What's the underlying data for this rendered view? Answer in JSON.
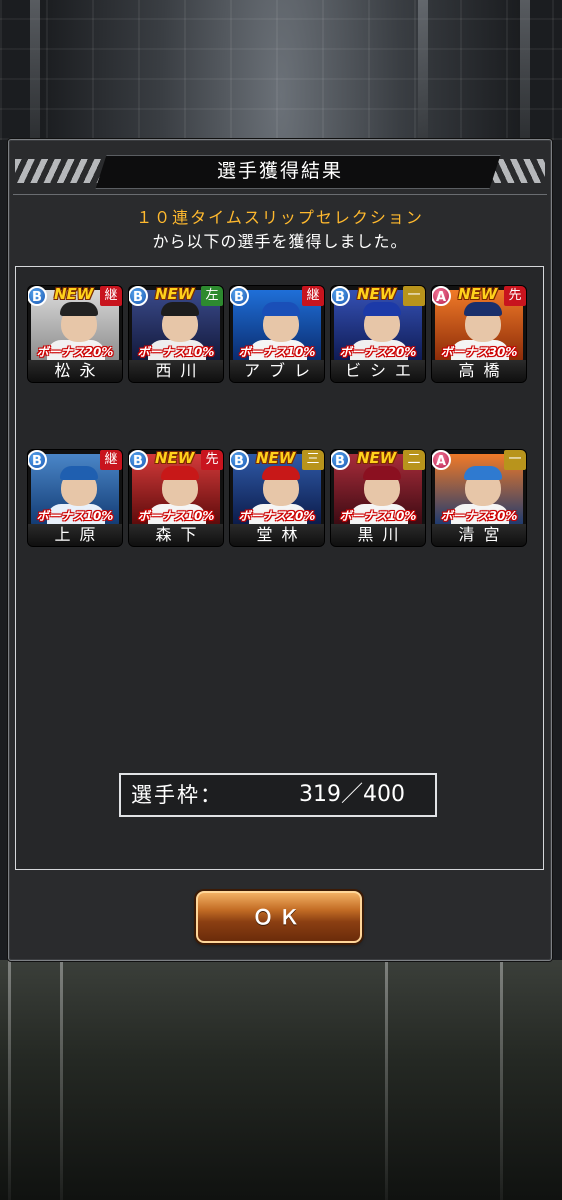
{
  "dialog": {
    "title": "選手獲得結果",
    "subtitle_highlight": "１０連タイムスリップセレクション",
    "subtitle_text": "から以下の選手を獲得しました。"
  },
  "players": [
    {
      "name": "松永",
      "rank": "B",
      "position": "継",
      "position_color": "#c8141e",
      "bonus": "ボーナス20%",
      "is_new": true,
      "new_label": "NEW"
    },
    {
      "name": "西川",
      "rank": "B",
      "position": "左",
      "position_color": "#2d8a2f",
      "bonus": "ボーナス10%",
      "is_new": true,
      "new_label": "NEW"
    },
    {
      "name": "アブレウ",
      "rank": "B",
      "position": "継",
      "position_color": "#c8141e",
      "bonus": "ボーナス10%",
      "is_new": false,
      "new_label": ""
    },
    {
      "name": "ビシエド",
      "rank": "B",
      "position": "一",
      "position_color": "#b8941c",
      "bonus": "ボーナス20%",
      "is_new": true,
      "new_label": "NEW"
    },
    {
      "name": "高橋",
      "rank": "A",
      "position": "先",
      "position_color": "#c8141e",
      "bonus": "ボーナス30%",
      "is_new": true,
      "new_label": "NEW"
    },
    {
      "name": "上原",
      "rank": "B",
      "position": "継",
      "position_color": "#c8141e",
      "bonus": "ボーナス10%",
      "is_new": false,
      "new_label": ""
    },
    {
      "name": "森下",
      "rank": "B",
      "position": "先",
      "position_color": "#c8141e",
      "bonus": "ボーナス10%",
      "is_new": true,
      "new_label": "NEW"
    },
    {
      "name": "堂林",
      "rank": "B",
      "position": "三",
      "position_color": "#b8941c",
      "bonus": "ボーナス20%",
      "is_new": true,
      "new_label": "NEW"
    },
    {
      "name": "黒川",
      "rank": "B",
      "position": "二",
      "position_color": "#b8941c",
      "bonus": "ボーナス10%",
      "is_new": true,
      "new_label": "NEW"
    },
    {
      "name": "清宮",
      "rank": "A",
      "position": "一",
      "position_color": "#b8941c",
      "bonus": "ボーナス30%",
      "is_new": false,
      "new_label": ""
    }
  ],
  "roster": {
    "label": "選手枠：",
    "value": "319／400"
  },
  "ok_button": {
    "label": "ＯＫ"
  }
}
